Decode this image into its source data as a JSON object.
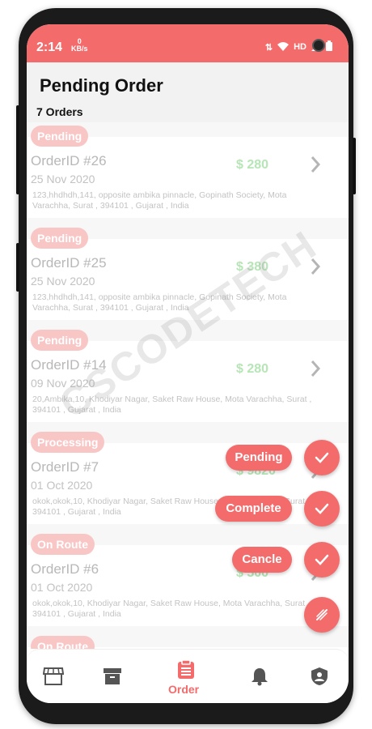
{
  "status_bar": {
    "time": "2:14",
    "kbps_value": "0",
    "kbps_unit": "KB/s",
    "hd": "HD"
  },
  "header": {
    "title": "Pending Order",
    "count": "7 Orders"
  },
  "orders": [
    {
      "status": "Pending",
      "id": "OrderID #26",
      "date": "25 Nov 2020",
      "price": "$ 280",
      "address": "123,hhdhdh,141, opposite ambika pinnacle, Gopinath Society, Mota Varachha, Surat , 394101 , Gujarat , India"
    },
    {
      "status": "Pending",
      "id": "OrderID #25",
      "date": "25 Nov 2020",
      "price": "$ 380",
      "address": "123,hhdhdh,141, opposite ambika pinnacle, Gopinath Society, Mota Varachha, Surat , 394101 , Gujarat , India"
    },
    {
      "status": "Pending",
      "id": "OrderID #14",
      "date": "09 Nov 2020",
      "price": "$ 280",
      "address": "20,Ambika,10, Khodiyar Nagar, Saket Raw House, Mota Varachha, Surat , 394101 , Gujarat , India"
    },
    {
      "status": "Processing",
      "id": "OrderID #7",
      "date": "01 Oct 2020",
      "price": "$ 9820",
      "address": "okok,okok,10, Khodiyar Nagar, Saket Raw House, Mota Varachha, Surat , 394101 , Gujarat , India"
    },
    {
      "status": "On Route",
      "id": "OrderID #6",
      "date": "01 Oct 2020",
      "price": "$ 500",
      "address": "okok,okok,10, Khodiyar Nagar, Saket Raw House, Mota Varachha, Surat , 394101 , Gujarat , India"
    },
    {
      "status": "On Route"
    }
  ],
  "watermark": "CSCODETECH",
  "fab_menu": {
    "pending": "Pending",
    "complete": "Complete",
    "cancel": "Cancle"
  },
  "bottom_nav": {
    "active_label": "Order"
  },
  "colors": {
    "accent": "#f46b6b",
    "badge": "#f9c6c6",
    "price": "#b6e6b6"
  }
}
